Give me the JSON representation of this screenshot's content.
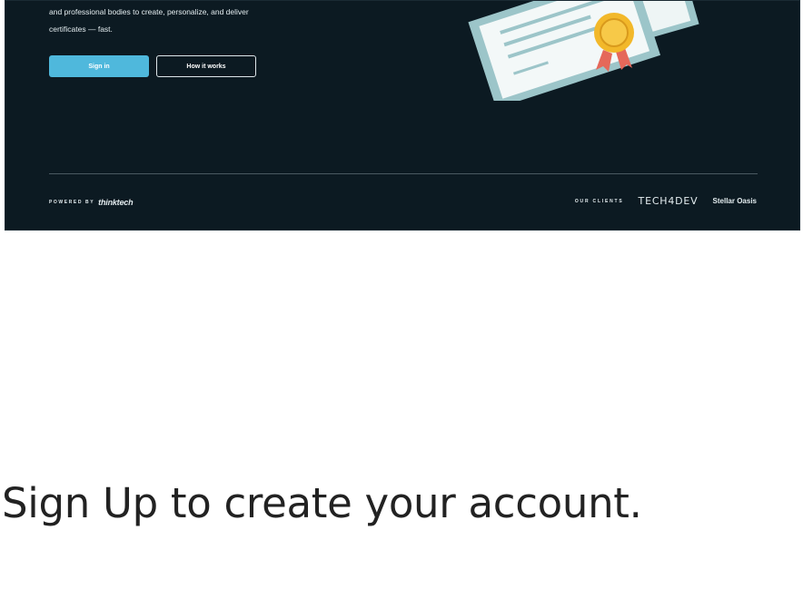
{
  "hero": {
    "description": "and professional bodies to create, personalize, and deliver\ncertificates — fast.",
    "signin_label": "Sign in",
    "how_label": "How it works",
    "powered_label": "POWERED BY",
    "powered_brand": "thinktech",
    "clients_label": "OUR CLIENTS",
    "client_one": "TECH4DEV",
    "client_two": "Stellar Oasis"
  },
  "colors": {
    "hero_bg": "#0c1a22",
    "primary_button": "#4fb8dc",
    "certificate": "#9cc5c9",
    "seal": "#f2b82a",
    "ribbon": "#e5685a"
  },
  "icons": {
    "certificate": "certificate-illustration-icon"
  },
  "signup": {
    "title": "Sign Up to create your account."
  }
}
